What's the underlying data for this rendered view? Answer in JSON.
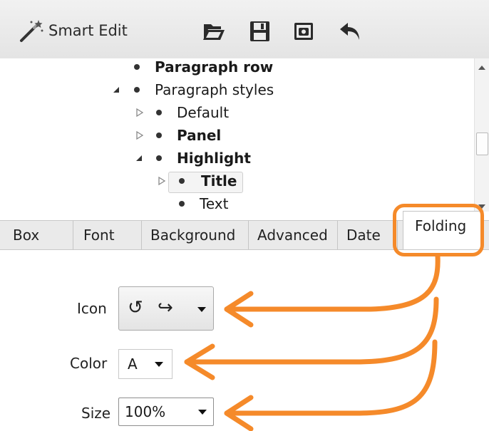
{
  "toolbar": {
    "smart_edit_label": "Smart Edit",
    "buttons": [
      {
        "name": "open-folder",
        "icon": "folder-icon"
      },
      {
        "name": "save",
        "icon": "floppy-disk-icon"
      },
      {
        "name": "screenshot",
        "icon": "camera-icon"
      },
      {
        "name": "undo",
        "icon": "undo-arrow-icon"
      }
    ]
  },
  "tree": {
    "items": [
      {
        "label": "Paragraph row",
        "bold": true,
        "level": 0,
        "expander": "none"
      },
      {
        "label": "Paragraph styles",
        "bold": false,
        "level": 0,
        "expander": "expanded"
      },
      {
        "label": "Default",
        "bold": false,
        "level": 1,
        "expander": "collapsed"
      },
      {
        "label": "Panel",
        "bold": true,
        "level": 1,
        "expander": "collapsed"
      },
      {
        "label": "Highlight",
        "bold": true,
        "level": 1,
        "expander": "expanded"
      },
      {
        "label": "Title",
        "bold": true,
        "level": 2,
        "expander": "collapsed",
        "selected": true
      },
      {
        "label": "Text",
        "bold": false,
        "level": 2,
        "expander": "none"
      }
    ]
  },
  "tabs": [
    {
      "label": "Box"
    },
    {
      "label": "Font"
    },
    {
      "label": "Background"
    },
    {
      "label": "Advanced"
    },
    {
      "label": "Date"
    },
    {
      "label": "Folding",
      "active": true
    }
  ],
  "form": {
    "icon_label": "Icon",
    "icon_value": "↺ ↪",
    "color_label": "Color",
    "color_value": "A",
    "size_label": "Size",
    "size_value": "100%"
  },
  "colors": {
    "callout": "#f58a2a",
    "bullet": "#333333",
    "tab_bar": "#eaeaea"
  }
}
